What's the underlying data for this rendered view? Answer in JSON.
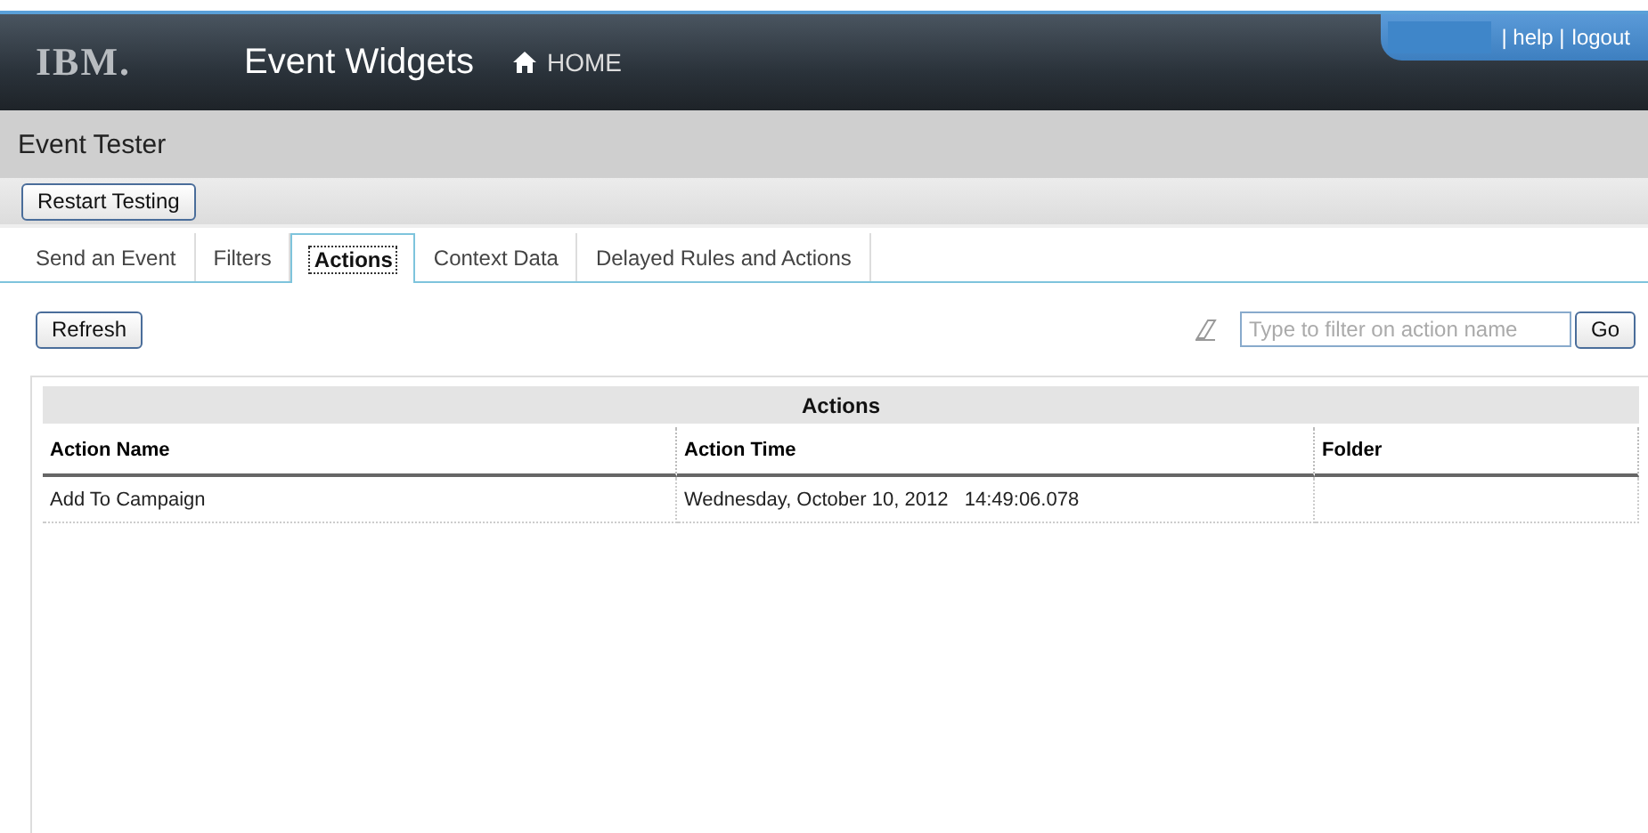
{
  "header": {
    "logo": "IBM.",
    "title": "Event Widgets",
    "home_link": "HOME",
    "user_links": [
      "| help |",
      "logout"
    ]
  },
  "page_title": "Event Tester",
  "toolbar": {
    "button": "Restart Testing"
  },
  "tabs": [
    {
      "label": "Send an Event",
      "selected": false
    },
    {
      "label": "Filters",
      "selected": false
    },
    {
      "label": "Actions",
      "selected": true
    },
    {
      "label": "Context Data",
      "selected": false
    },
    {
      "label": "Delayed Rules and Actions",
      "selected": false
    }
  ],
  "actions_bar": {
    "refresh_button": "Refresh",
    "filter": {
      "placeholder": "Type to filter on action name"
    },
    "go_button": "Go"
  },
  "table": {
    "title": "Actions",
    "columns": [
      "Action Name",
      "Action Time",
      "Folder"
    ],
    "rows": [
      [
        "Add To Campaign",
        "Wednesday, October 10, 2012   14:49:06.078"
      ]
    ]
  }
}
